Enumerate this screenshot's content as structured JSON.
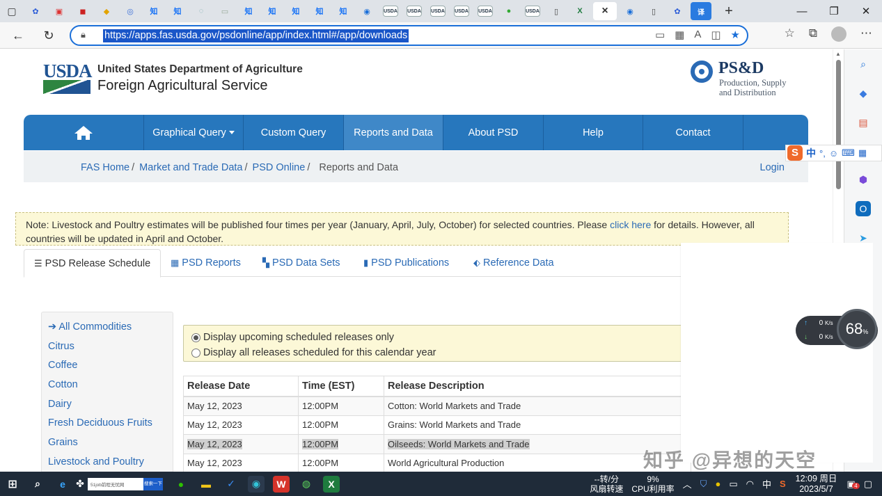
{
  "browser": {
    "url": "https://apps.fas.usda.gov/psdonline/app/index.html#/app/downloads",
    "tab_icons": [
      "tab-list",
      "baidu",
      "pdf",
      "pdf-red",
      "yellow",
      "search",
      "zhi",
      "zhi",
      "circle",
      "doc",
      "zhi",
      "zhi",
      "zhi",
      "zhi",
      "zhi",
      "edge",
      "usda",
      "usda",
      "usda",
      "usda",
      "usda",
      "green",
      "usda",
      "page",
      "excel",
      "active",
      "edge",
      "page",
      "baidu",
      "translate"
    ],
    "usda_tab_label": "USDA",
    "zhi_label": "知",
    "new_tab": "+",
    "close_tab": "×",
    "win_min": "—",
    "win_max": "❐",
    "win_close": "✕"
  },
  "header": {
    "usda_letters": "USDA",
    "department": "United States Department of Agriculture",
    "agency": "Foreign Agricultural Service",
    "psd_title": "PS&D",
    "psd_subtitle_1": "Production, Supply",
    "psd_subtitle_2": "and Distribution"
  },
  "nav": {
    "items": [
      "Graphical Query",
      "Custom Query",
      "Reports and Data",
      "About PSD",
      "Help",
      "Contact"
    ],
    "active": "Reports and Data"
  },
  "breadcrumb": {
    "items": [
      "FAS Home",
      "Market and Trade Data",
      "PSD Online"
    ],
    "current": "Reports and Data",
    "login": "Login"
  },
  "note": {
    "before_link": "Note: Livestock and Poultry estimates will be published four times per year (January, April, July, October) for selected countries. Please ",
    "link": "click here",
    "after_link": " for details. However, all countries will be updated in April and October."
  },
  "tabs": [
    {
      "label": "PSD Release Schedule",
      "glyph": "☰"
    },
    {
      "label": "PSD Reports",
      "glyph": "▦"
    },
    {
      "label": "PSD Data Sets",
      "glyph": "▚"
    },
    {
      "label": "PSD Publications",
      "glyph": "▮"
    },
    {
      "label": "Reference Data",
      "glyph": "⬖"
    }
  ],
  "commodities": {
    "all": "All Commodities",
    "items": [
      "Citrus",
      "Coffee",
      "Cotton",
      "Dairy",
      "Fresh Deciduous Fruits",
      "Grains",
      "Livestock and Poultry"
    ]
  },
  "release_filter": {
    "upcoming": "Display upcoming scheduled releases only",
    "all_year": "Display all releases scheduled for this calendar year",
    "selected": "upcoming"
  },
  "release_table": {
    "headers": [
      "Release Date",
      "Time (EST)",
      "Release Description"
    ],
    "rows": [
      [
        "May 12, 2023",
        "12:00PM",
        "Cotton: World Markets and Trade"
      ],
      [
        "May 12, 2023",
        "12:00PM",
        "Grains: World Markets and Trade"
      ],
      [
        "May 12, 2023",
        "12:00PM",
        "Oilseeds: World Markets and Trade"
      ],
      [
        "May 12, 2023",
        "12:00PM",
        "World Agricultural Production"
      ]
    ]
  },
  "ime": {
    "zh": "中",
    "punct": "°,"
  },
  "net_widget": {
    "up": "0",
    "down": "0",
    "unit": "K/s",
    "percent": "68",
    "pct_sign": "%"
  },
  "watermark": "知乎 @异想的天空",
  "taskbar": {
    "search_text": "51job前程无忧网",
    "search_button": "搜索一下",
    "fan_label_1": "--转/分",
    "fan_label_2": "风扇转速",
    "cpu_value": "9%",
    "cpu_label": "CPU利用率",
    "ime_lang": "中",
    "time": "12:09 周日",
    "date": "2023/5/7",
    "badge": "4"
  }
}
